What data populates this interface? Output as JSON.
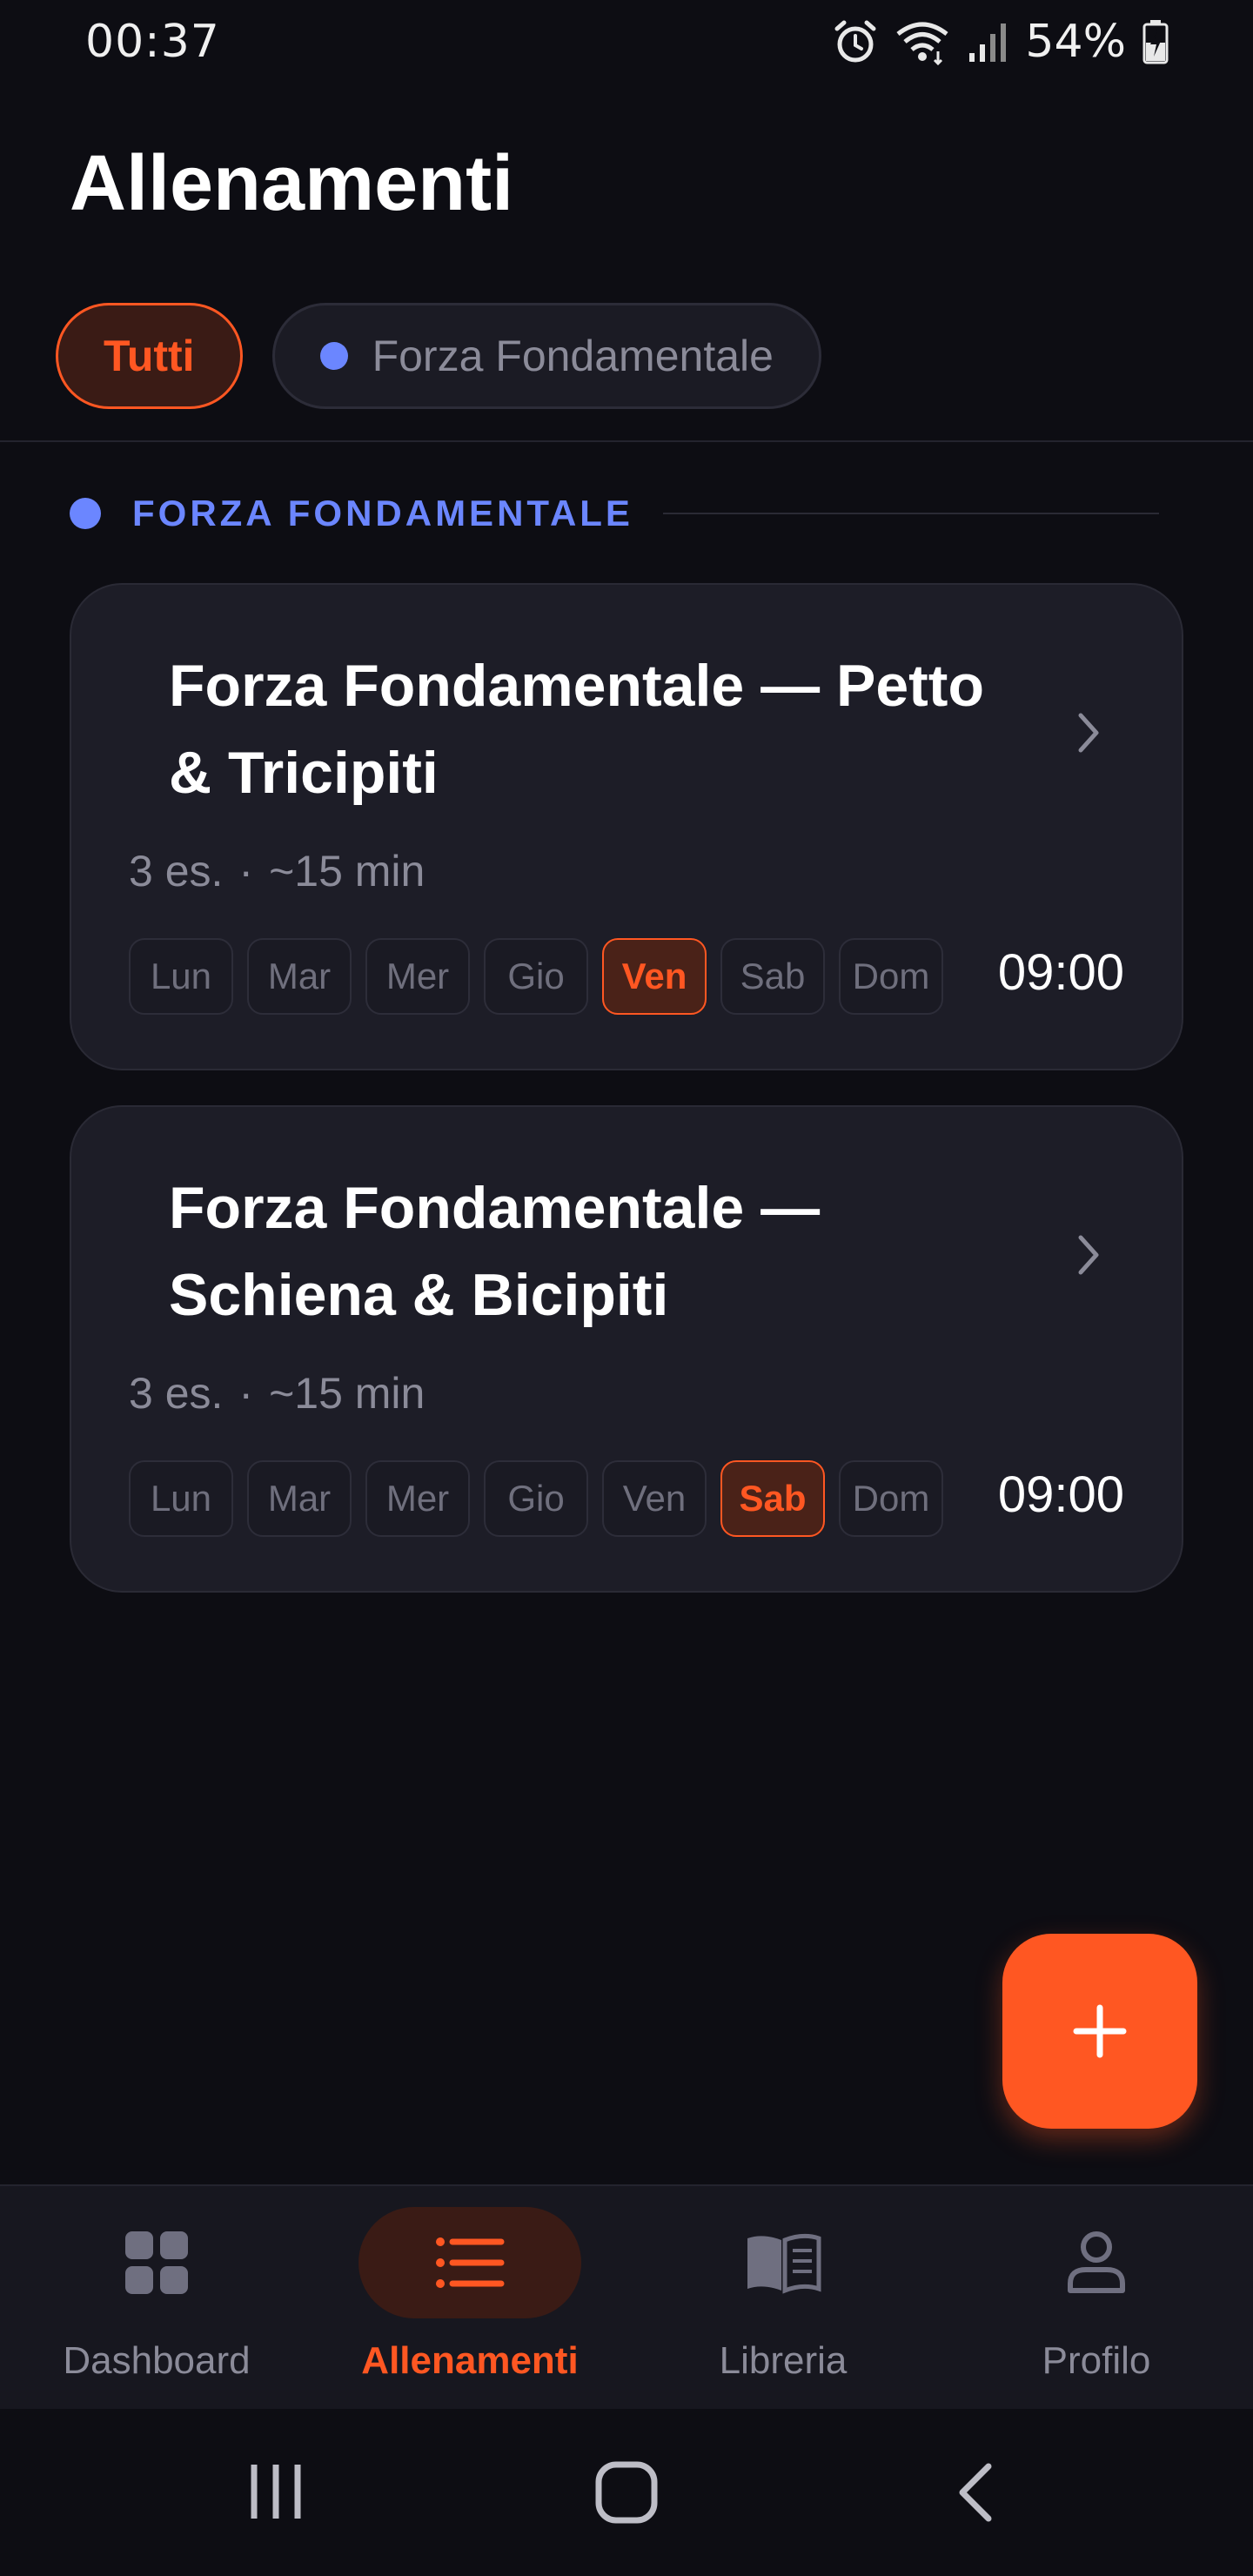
{
  "status_bar": {
    "time": "00:37",
    "battery": "54%",
    "icons": [
      "alarm-icon",
      "wifi-icon",
      "signal-icon",
      "battery-charging-icon"
    ]
  },
  "page": {
    "title": "Allenamenti"
  },
  "filters": {
    "chips": [
      {
        "label": "Tutti",
        "active": true
      },
      {
        "label": "Forza Fondamentale",
        "active": false,
        "dot_color": "#6b86ff"
      }
    ]
  },
  "section": {
    "label": "FORZA FONDAMENTALE",
    "color": "#6b86ff"
  },
  "workouts": [
    {
      "title": "Forza Fondamentale — Petto & Tricipiti",
      "exercises": "3 es.",
      "separator": "·",
      "duration": "~15 min",
      "days": [
        "Lun",
        "Mar",
        "Mer",
        "Gio",
        "Ven",
        "Sab",
        "Dom"
      ],
      "active_day": "Ven",
      "time": "09:00"
    },
    {
      "title": "Forza Fondamentale — Schiena & Bicipiti",
      "exercises": "3 es.",
      "separator": "·",
      "duration": "~15 min",
      "days": [
        "Lun",
        "Mar",
        "Mer",
        "Gio",
        "Ven",
        "Sab",
        "Dom"
      ],
      "active_day": "Sab",
      "time": "09:00"
    }
  ],
  "fab": {
    "icon": "plus-icon"
  },
  "bottom_nav": {
    "items": [
      {
        "label": "Dashboard",
        "icon": "dashboard-icon",
        "active": false
      },
      {
        "label": "Allenamenti",
        "icon": "list-icon",
        "active": true
      },
      {
        "label": "Libreria",
        "icon": "book-icon",
        "active": false
      },
      {
        "label": "Profilo",
        "icon": "user-icon",
        "active": false
      }
    ]
  },
  "colors": {
    "accent": "#ff5722",
    "background": "#0d0d13",
    "card": "#1d1d27",
    "muted_text": "#8b8b99"
  }
}
